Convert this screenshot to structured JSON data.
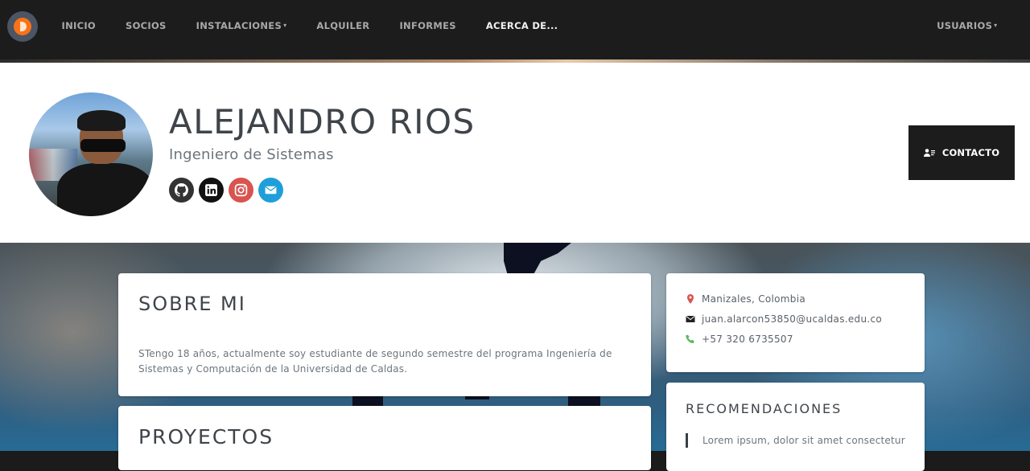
{
  "navbar": {
    "brand_icon": "flame-logo-icon",
    "links": [
      {
        "label": "INICIO",
        "dropdown": false,
        "active": false
      },
      {
        "label": "SOCIOS",
        "dropdown": false,
        "active": false
      },
      {
        "label": "INSTALACIONES",
        "dropdown": true,
        "active": false
      },
      {
        "label": "ALQUILER",
        "dropdown": false,
        "active": false
      },
      {
        "label": "INFORMES",
        "dropdown": false,
        "active": false
      },
      {
        "label": "ACERCA DE...",
        "dropdown": false,
        "active": true
      }
    ],
    "users_label": "USUARIOS",
    "caret": "▾"
  },
  "profile": {
    "name": "ALEJANDRO RIOS",
    "title": "Ingeniero de Sistemas",
    "socials": [
      {
        "icon": "github-icon",
        "color": "#333333"
      },
      {
        "icon": "linkedin-icon",
        "color": "#111111"
      },
      {
        "icon": "instagram-icon",
        "color": "#d9534f"
      },
      {
        "icon": "email-icon",
        "color": "#1e9fd9"
      }
    ],
    "contact_button_label": "CONTACTO"
  },
  "about": {
    "title": "SOBRE MI",
    "text": "STengo 18 años, actualmente soy estudiante de segundo semestre del programa Ingeniería de Sistemas y Computación de la Universidad de Caldas."
  },
  "projects": {
    "title": "PROYECTOS"
  },
  "info": {
    "location": "Manizales, Colombia",
    "email": "juan.alarcon53850@ucaldas.edu.co",
    "phone": "+57 320 6735507"
  },
  "recommendations": {
    "title": "RECOMENDACIONES",
    "quote": "Lorem ipsum, dolor sit amet consectetur"
  },
  "colors": {
    "navbar_bg": "#1c1c1c",
    "location_icon": "#d9534f",
    "phone_icon": "#5cb85c"
  }
}
